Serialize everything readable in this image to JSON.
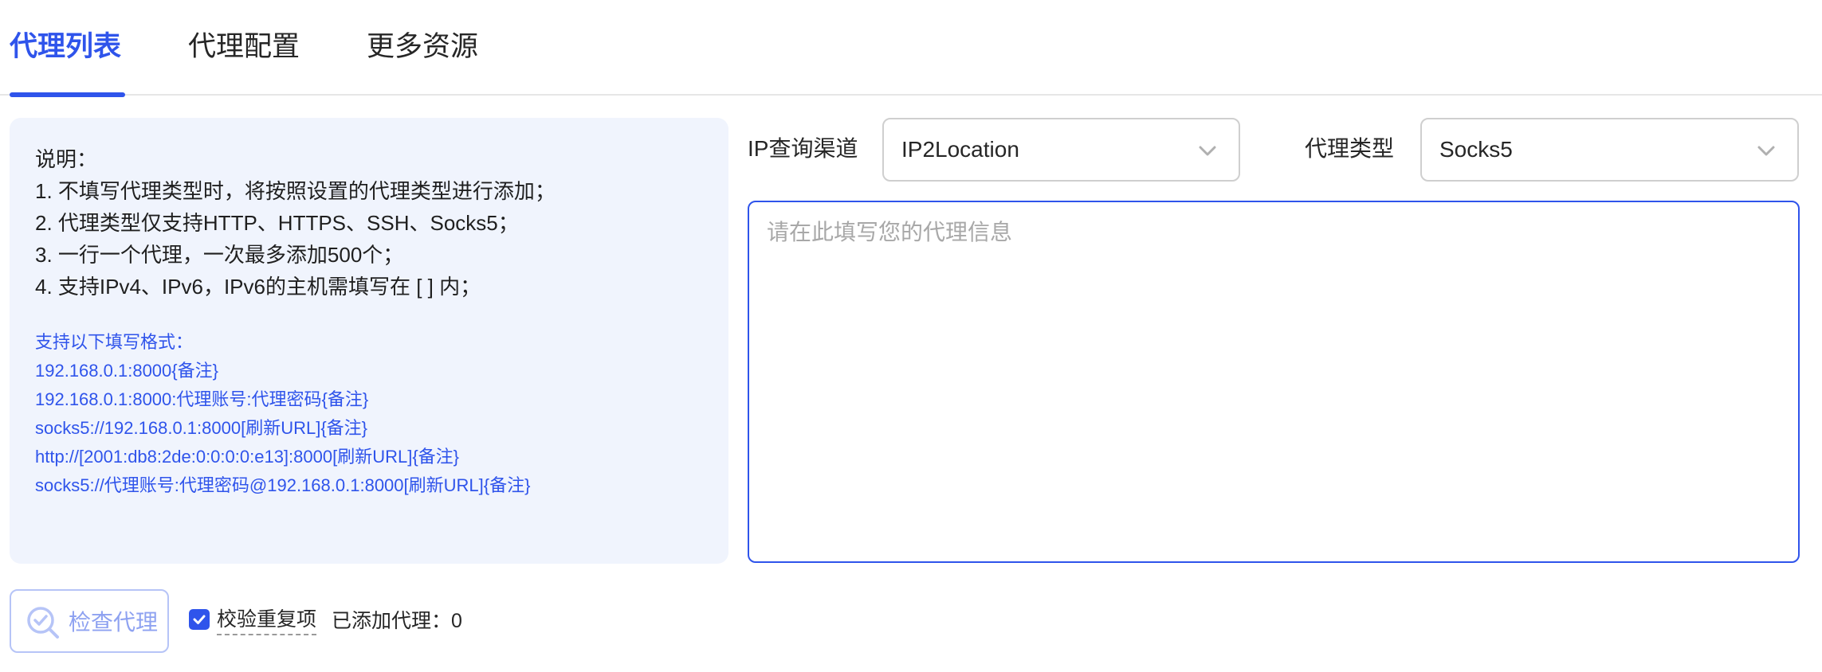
{
  "tabs": [
    {
      "label": "代理列表",
      "active": true
    },
    {
      "label": "代理配置",
      "active": false
    },
    {
      "label": "更多资源",
      "active": false
    }
  ],
  "info": {
    "title": "说明：",
    "notes": [
      "1. 不填写代理类型时，将按照设置的代理类型进行添加；",
      "2. 代理类型仅支持HTTP、HTTPS、SSH、Socks5；",
      "3. 一行一个代理，一次最多添加500个；",
      "4. 支持IPv4、IPv6，IPv6的主机需填写在 [ ] 内；"
    ],
    "formats_title": "支持以下填写格式：",
    "formats": [
      "192.168.0.1:8000{备注}",
      "192.168.0.1:8000:代理账号:代理密码{备注}",
      "socks5://192.168.0.1:8000[刷新URL]{备注}",
      "http://[2001:db8:2de:0:0:0:0:e13]:8000[刷新URL]{备注}",
      "socks5://代理账号:代理密码@192.168.0.1:8000[刷新URL]{备注}"
    ]
  },
  "ip_channel": {
    "label": "IP查询渠道",
    "value": "IP2Location"
  },
  "proxy_type": {
    "label": "代理类型",
    "value": "Socks5"
  },
  "proxy_input": {
    "placeholder": "请在此填写您的代理信息",
    "value": ""
  },
  "footer": {
    "check_button": "检查代理",
    "dedupe_label": "校验重复项",
    "dedupe_checked": true,
    "added_label": "已添加代理：0"
  },
  "colors": {
    "accent": "#2f54eb",
    "panel_bg": "#f0f4fd"
  }
}
